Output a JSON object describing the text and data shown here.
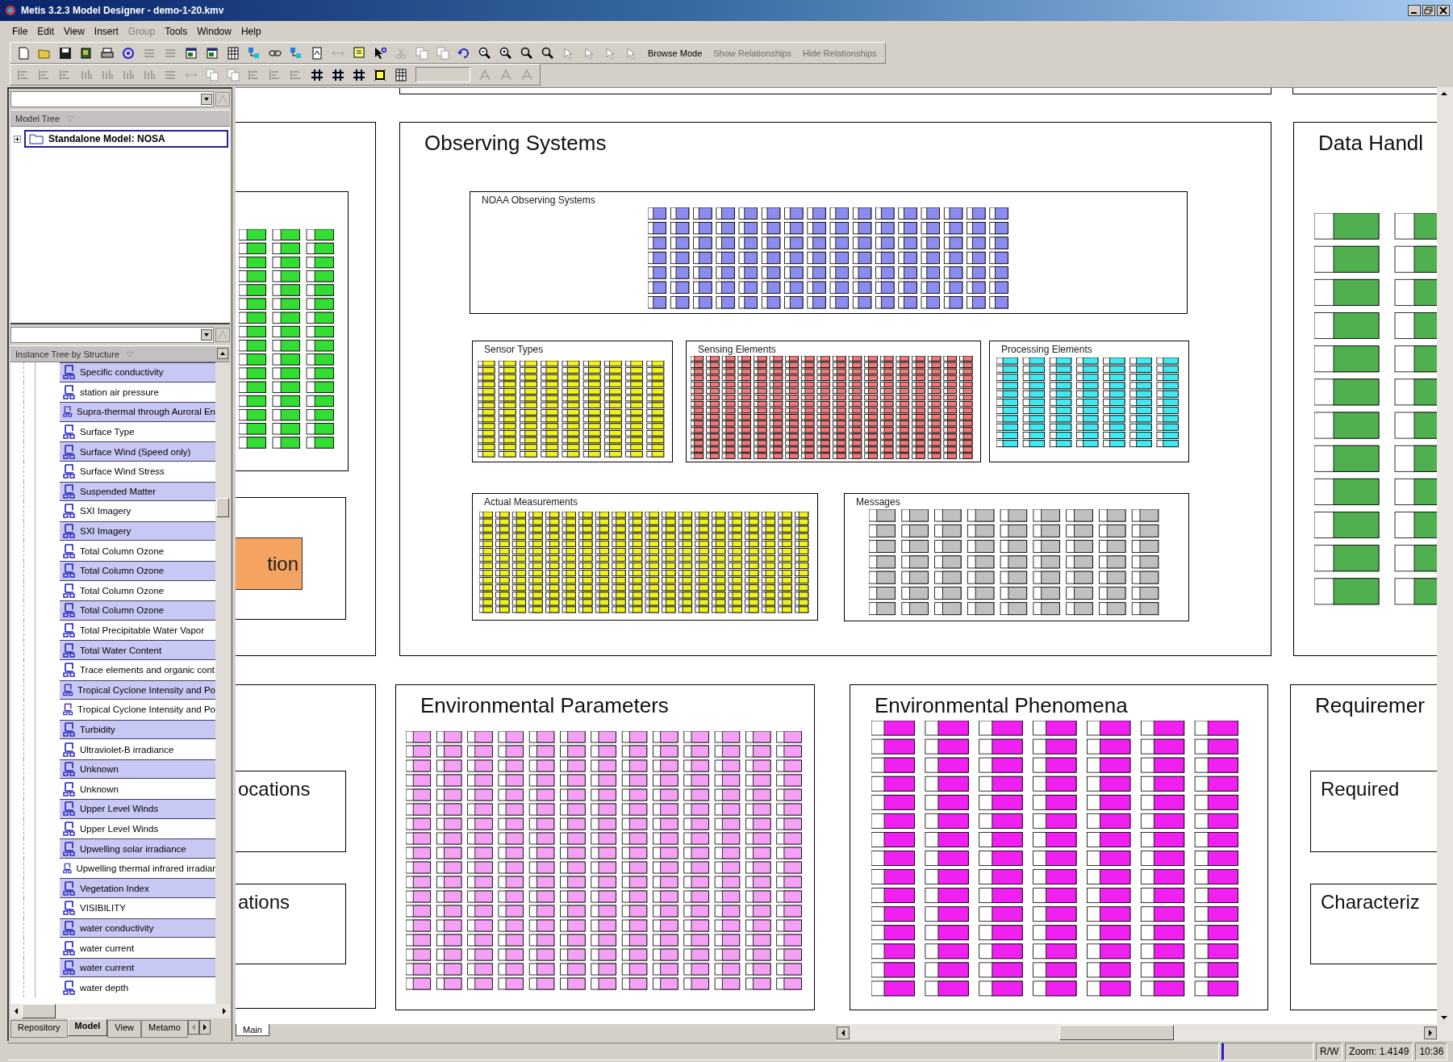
{
  "window": {
    "title": "Metis 3.2.3 Model Designer - demo-1-20.kmv"
  },
  "menu": [
    {
      "label": "File",
      "disabled": false
    },
    {
      "label": "Edit",
      "disabled": false
    },
    {
      "label": "View",
      "disabled": false
    },
    {
      "label": "Insert",
      "disabled": false
    },
    {
      "label": "Group",
      "disabled": true
    },
    {
      "label": "Tools",
      "disabled": false
    },
    {
      "label": "Window",
      "disabled": false
    },
    {
      "label": "Help",
      "disabled": false
    }
  ],
  "toolbar": {
    "buttons": [
      {
        "label": "Browse Mode",
        "disabled": false
      },
      {
        "label": "Show Relationships",
        "disabled": true
      },
      {
        "label": "Hide Relationships",
        "disabled": true
      }
    ]
  },
  "model_tree": {
    "header": "Model Tree",
    "items": [
      {
        "label": "Standalone Model: NOSA",
        "selected": true
      }
    ]
  },
  "instance_tree": {
    "header": "Instance Tree by Structure",
    "items": [
      {
        "label": "Specific conductivity",
        "selected": true
      },
      {
        "label": "station air pressure",
        "selected": false
      },
      {
        "label": "Supra-thermal through Auroral En",
        "selected": true
      },
      {
        "label": "Surface Type",
        "selected": false
      },
      {
        "label": "Surface Wind (Speed only)",
        "selected": true
      },
      {
        "label": "Surface Wind Stress",
        "selected": false
      },
      {
        "label": "Suspended Matter",
        "selected": true
      },
      {
        "label": "SXI Imagery",
        "selected": false
      },
      {
        "label": "SXI Imagery",
        "selected": true
      },
      {
        "label": "Total Column Ozone",
        "selected": false
      },
      {
        "label": "Total Column Ozone",
        "selected": true
      },
      {
        "label": "Total Column Ozone",
        "selected": false
      },
      {
        "label": "Total Column Ozone",
        "selected": true
      },
      {
        "label": "Total Precipitable Water Vapor",
        "selected": false
      },
      {
        "label": "Total Water Content",
        "selected": true
      },
      {
        "label": "Trace elements and organic cont",
        "selected": false
      },
      {
        "label": "Tropical Cyclone Intensity and Po",
        "selected": true
      },
      {
        "label": "Tropical Cyclone Intensity and Po",
        "selected": false
      },
      {
        "label": "Turbidity",
        "selected": true
      },
      {
        "label": "Ultraviolet-B irradiance",
        "selected": false
      },
      {
        "label": "Unknown",
        "selected": true
      },
      {
        "label": "Unknown",
        "selected": false
      },
      {
        "label": "Upper Level Winds",
        "selected": true
      },
      {
        "label": "Upper Level Winds",
        "selected": false
      },
      {
        "label": "Upwelling solar irradiance",
        "selected": true
      },
      {
        "label": "Upwelling thermal infrared irradiar",
        "selected": false
      },
      {
        "label": "Vegetation Index",
        "selected": true
      },
      {
        "label": "VISIBILITY",
        "selected": false
      },
      {
        "label": "water conductivity",
        "selected": true
      },
      {
        "label": "water current",
        "selected": false
      },
      {
        "label": "water current",
        "selected": true
      },
      {
        "label": "water depth",
        "selected": false
      }
    ]
  },
  "panel_tabs": [
    {
      "label": "Repository",
      "selected": false
    },
    {
      "label": "Model",
      "selected": true
    },
    {
      "label": "View",
      "selected": false
    },
    {
      "label": "Metamo",
      "selected": false
    }
  ],
  "diagram": {
    "tabs": [
      {
        "label": "Main",
        "selected": true
      }
    ],
    "nodes": [
      {
        "kind": "frame"
      },
      {
        "kind": "frame"
      },
      {
        "kind": "container"
      },
      {
        "kind": "group",
        "color": "#33dd33"
      },
      {
        "kind": "frame"
      },
      {
        "kind": "object",
        "label": "tion",
        "color": "#f4a460"
      },
      {
        "kind": "container",
        "title": "Observing Systems"
      },
      {
        "kind": "group",
        "title": "NOAA Observing Systems",
        "color": "#8c8cf0"
      },
      {
        "kind": "group",
        "title": "Sensor Types",
        "color": "#f0f020"
      },
      {
        "kind": "group",
        "title": "Sensing Elements",
        "color": "#f07878"
      },
      {
        "kind": "group",
        "title": "Processing Elements",
        "color": "#40e8f0"
      },
      {
        "kind": "group",
        "title": "Actual Measurements",
        "color": "#f0f020"
      },
      {
        "kind": "group",
        "title": "Messages",
        "color": "#c0c0c0"
      },
      {
        "kind": "container",
        "title": "Data Handl"
      },
      {
        "kind": "grid",
        "color": "#50b050"
      },
      {
        "kind": "container"
      },
      {
        "kind": "frame",
        "label": "ocations"
      },
      {
        "kind": "frame",
        "label": "ations"
      },
      {
        "kind": "container",
        "title": "Environmental Parameters",
        "color": "#f4a0f4"
      },
      {
        "kind": "container",
        "title": "Environmental Phenomena",
        "color": "#f020f0"
      },
      {
        "kind": "container",
        "title": "Requiremer"
      },
      {
        "kind": "frame",
        "label": "Required"
      },
      {
        "kind": "frame",
        "label": "Characteriz"
      }
    ]
  },
  "status_bar": {
    "mode": "R/W",
    "zoom": "Zoom: 1.4149",
    "time": "10:36"
  }
}
